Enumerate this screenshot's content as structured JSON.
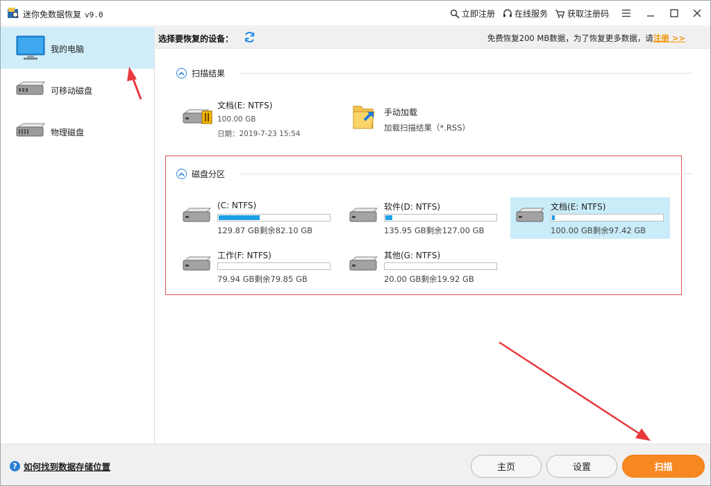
{
  "app": {
    "title": "迷你免数据恢复",
    "version": "v9.0",
    "links": {
      "register": "立即注册",
      "service": "在线服务",
      "get_code": "获取注册码"
    }
  },
  "sidebar": {
    "items": [
      {
        "label": "我的电脑",
        "icon": "monitor-icon",
        "active": true
      },
      {
        "label": "可移动磁盘",
        "icon": "removable-disk-icon",
        "active": false
      },
      {
        "label": "物理磁盘",
        "icon": "physical-disk-icon",
        "active": false
      }
    ]
  },
  "device_bar": {
    "label": "选择要恢复的设备：",
    "notice": "免费恢复200 MB数据，为了恢复更多数据，请",
    "register_link": "注册 >>"
  },
  "scan_results": {
    "title": "扫描结果",
    "items": [
      {
        "name": "文档(E: NTFS)",
        "size": "100.00 GB",
        "date": "日期：2019-7-23 15:54"
      },
      {
        "name": "手动加载",
        "desc": "加载扫描结果（*.RSS）"
      }
    ]
  },
  "partitions": {
    "title": "磁盘分区",
    "items": [
      {
        "name": "(C: NTFS)",
        "info": "129.87 GB剩余82.10 GB",
        "used_fraction": 0.368,
        "selected": false
      },
      {
        "name": "软件(D: NTFS)",
        "info": "135.95 GB剩余127.00 GB",
        "used_fraction": 0.066,
        "selected": false
      },
      {
        "name": "文档(E: NTFS)",
        "info": "100.00 GB剩余97.42 GB",
        "used_fraction": 0.026,
        "selected": true
      },
      {
        "name": "工作(F: NTFS)",
        "info": "79.94 GB剩余79.85 GB",
        "used_fraction": 0.001,
        "selected": false
      },
      {
        "name": "其他(G: NTFS)",
        "info": "20.00 GB剩余19.92 GB",
        "used_fraction": 0.004,
        "selected": false
      }
    ]
  },
  "footer": {
    "help_text": "如何找到数据存储位置",
    "home_button": "主页",
    "settings_button": "设置",
    "scan_button": "扫描"
  },
  "colors": {
    "accent_blue": "#1ea0e8",
    "selected_bg": "#c9ecf9",
    "orange": "#f78721",
    "annotation_red": "#e8383d"
  }
}
